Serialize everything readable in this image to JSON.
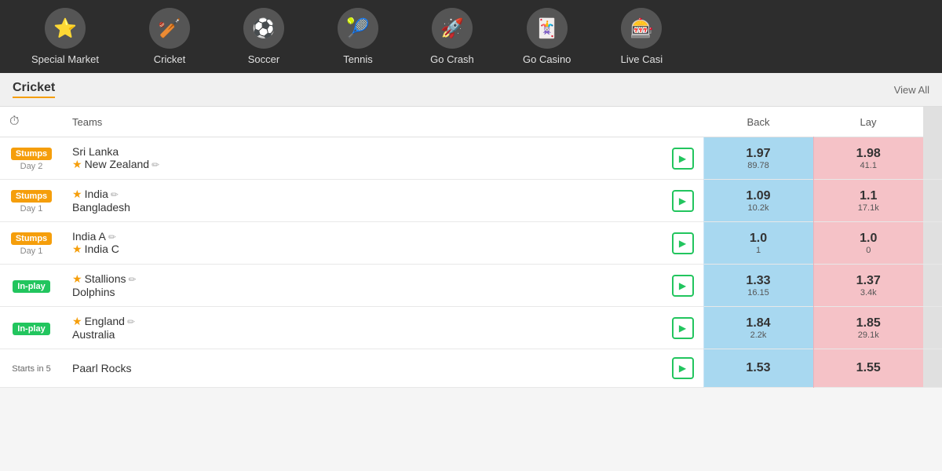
{
  "nav": {
    "items": [
      {
        "id": "special-market",
        "label": "Special Market",
        "icon": "⭐"
      },
      {
        "id": "cricket",
        "label": "Cricket",
        "icon": "🏏"
      },
      {
        "id": "soccer",
        "label": "Soccer",
        "icon": "⚽"
      },
      {
        "id": "tennis",
        "label": "Tennis",
        "icon": "🎾"
      },
      {
        "id": "go-crash",
        "label": "Go Crash",
        "icon": "🚀"
      },
      {
        "id": "go-casino",
        "label": "Go Casino",
        "icon": "🃏"
      },
      {
        "id": "live-casino",
        "label": "Live Casi",
        "icon": "🎰"
      }
    ]
  },
  "section": {
    "title": "Cricket",
    "view_all": "View All"
  },
  "table": {
    "headers": {
      "clock_icon": "⏱",
      "teams": "Teams",
      "back": "Back",
      "lay": "Lay"
    },
    "rows": [
      {
        "status_type": "stumps",
        "status_label": "Stumps",
        "day": "Day 2",
        "team1": "Sri Lanka",
        "team1_star": false,
        "team2": "New Zealand",
        "team2_star": true,
        "team2_pencil": true,
        "back_main": "1.97",
        "back_sub": "89.78",
        "lay_main": "1.98",
        "lay_sub": "41.1"
      },
      {
        "status_type": "stumps",
        "status_label": "Stumps",
        "day": "Day 1",
        "team1": "India",
        "team1_star": true,
        "team1_pencil": true,
        "team2": "Bangladesh",
        "team2_star": false,
        "back_main": "1.09",
        "back_sub": "10.2k",
        "lay_main": "1.1",
        "lay_sub": "17.1k"
      },
      {
        "status_type": "stumps",
        "status_label": "Stumps",
        "day": "Day 1",
        "team1": "India A",
        "team1_pencil": true,
        "team2": "India C",
        "team2_star": true,
        "back_main": "1.0",
        "back_sub": "1",
        "lay_main": "1.0",
        "lay_sub": "0"
      },
      {
        "status_type": "inplay",
        "status_label": "In-play",
        "team1": "Stallions",
        "team1_star": true,
        "team1_pencil": true,
        "team2": "Dolphins",
        "team2_star": false,
        "back_main": "1.33",
        "back_sub": "16.15",
        "lay_main": "1.37",
        "lay_sub": "3.4k"
      },
      {
        "status_type": "inplay",
        "status_label": "In-play",
        "team1": "England",
        "team1_star": true,
        "team1_pencil": true,
        "team2": "Australia",
        "team2_star": false,
        "back_main": "1.84",
        "back_sub": "2.2k",
        "lay_main": "1.85",
        "lay_sub": "29.1k"
      },
      {
        "status_type": "startsin",
        "status_label": "Starts in 5",
        "team1": "Paarl Rocks",
        "team1_star": false,
        "back_main": "1.53",
        "back_sub": "",
        "lay_main": "1.55",
        "lay_sub": ""
      }
    ]
  }
}
